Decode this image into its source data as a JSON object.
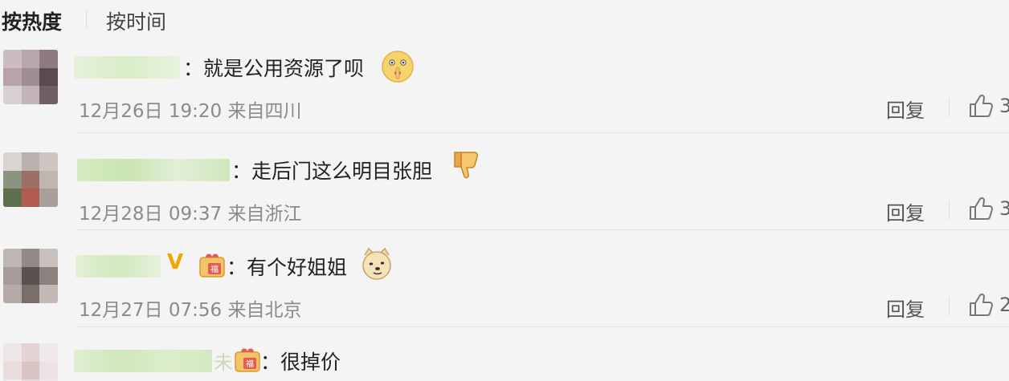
{
  "sort": {
    "active_label": "按热度",
    "inactive_label": "按时间"
  },
  "comments": [
    {
      "text": "：就是公用资源了呗",
      "emoji": "shh-face",
      "time": "12月26日 19:20 来自四川",
      "reply_label": "回复",
      "likes": "3"
    },
    {
      "text": "：走后门这么明目张胆",
      "emoji": "thumbs-down",
      "time": "12月28日 09:37 来自浙江",
      "reply_label": "回复",
      "likes": "3"
    },
    {
      "badge_v": "V",
      "text": "：有个好姐姐",
      "emoji": "doge",
      "time": "12月27日 07:56 来自北京",
      "reply_label": "回复",
      "likes": "2"
    },
    {
      "name_partial": "未",
      "text": "：很掉价"
    }
  ],
  "colors": {
    "background": "#f4f4f4",
    "name_blur": "#d9edc8",
    "verified": "#f2a400",
    "meta": "#8a8a8a"
  }
}
